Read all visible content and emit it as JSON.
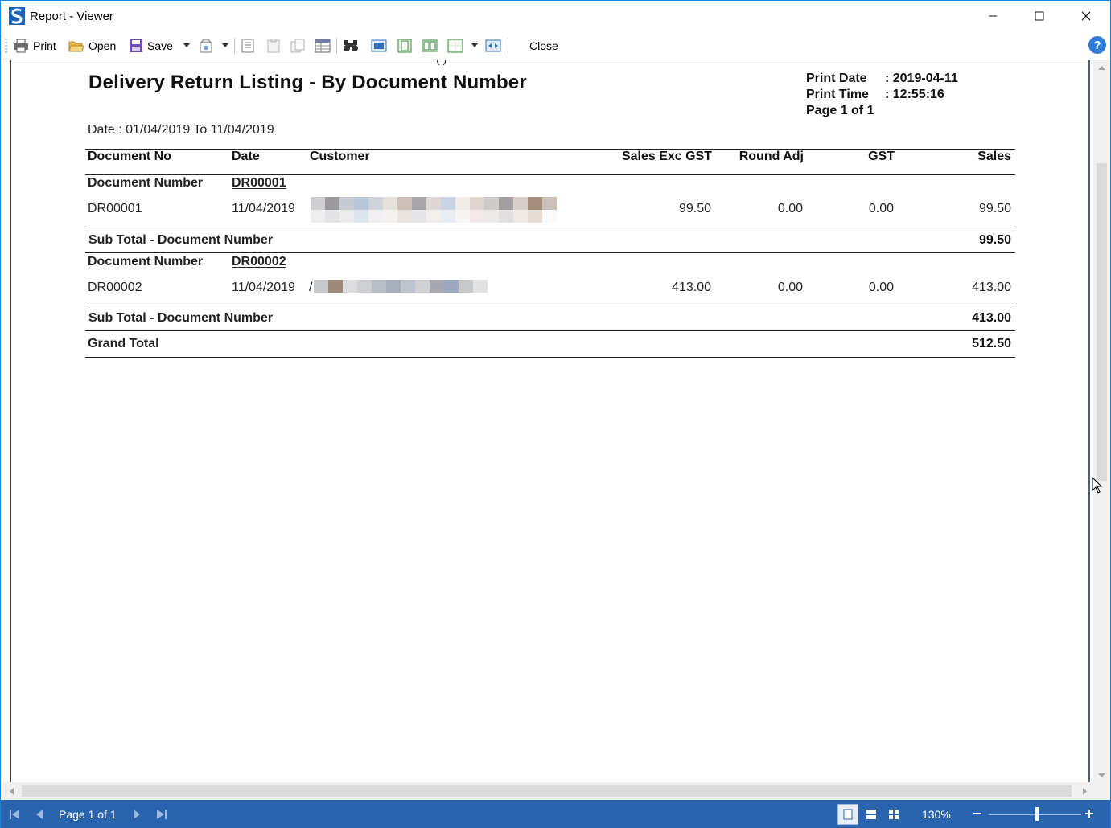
{
  "window": {
    "title": "Report - Viewer",
    "minimize_glyph": "—",
    "maximize_glyph": "☐",
    "close_glyph": "✕"
  },
  "toolbar": {
    "print_label": "Print",
    "open_label": "Open",
    "save_label": "Save",
    "close_label": "Close",
    "help_glyph": "?"
  },
  "report": {
    "partial_top_text": "(                                                    )",
    "title": "Delivery Return Listing - By Document Number",
    "print_date_key": "Print Date",
    "print_date_value": ": 2019-04-11",
    "print_time_key": "Print Time",
    "print_time_value": ": 12:55:16",
    "page_info": "Page 1 of 1",
    "date_range": "Date : 01/04/2019 To 11/04/2019",
    "columns": {
      "doc_no": "Document No",
      "date": "Date",
      "customer": "Customer",
      "sales_exc_gst": "Sales Exc GST",
      "round_adj": "Round Adj",
      "gst": "GST",
      "sales": "Sales"
    },
    "groups": [
      {
        "group_label": "Document Number",
        "group_value": "DR00001",
        "row": {
          "doc_no": "DR00001",
          "date": "11/04/2019",
          "sales_exc_gst": "99.50",
          "round_adj": "0.00",
          "gst": "0.00",
          "sales": "99.50"
        },
        "subtotal_label": "Sub Total - Document Number",
        "subtotal_value": "99.50"
      },
      {
        "group_label": "Document Number",
        "group_value": "DR00002",
        "row": {
          "doc_no": "DR00002",
          "date": "11/04/2019",
          "customer_prefix": "/",
          "sales_exc_gst": "413.00",
          "round_adj": "0.00",
          "gst": "0.00",
          "sales": "413.00"
        },
        "subtotal_label": "Sub Total - Document Number",
        "subtotal_value": "413.00"
      }
    ],
    "grand_total_label": "Grand Total",
    "grand_total_value": "512.50"
  },
  "statusbar": {
    "page_label": "Page 1 of 1",
    "zoom": "130%"
  },
  "colors": {
    "statusbar_bg": "#2a63ae",
    "window_border": "#1883d7",
    "help_icon": "#2d7bd4"
  }
}
